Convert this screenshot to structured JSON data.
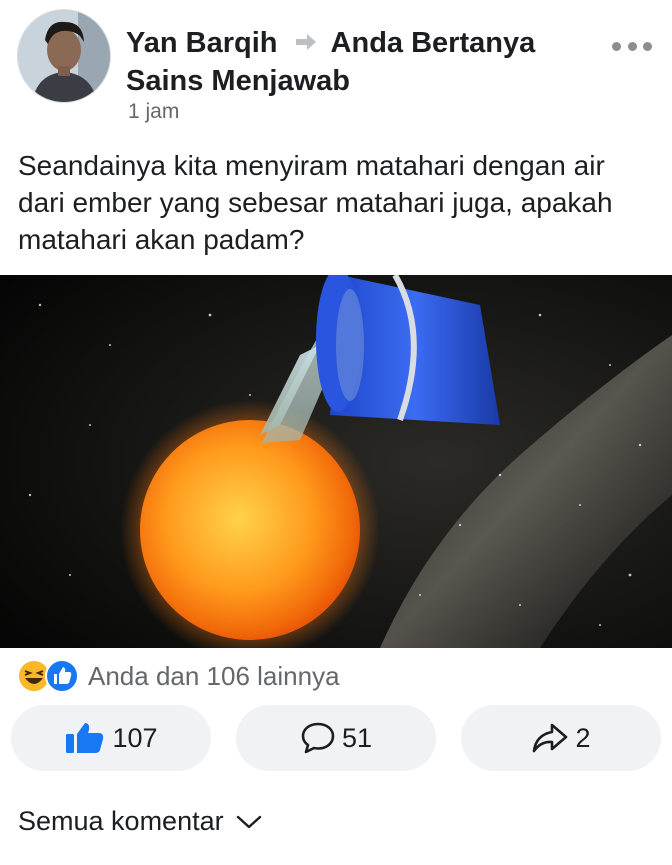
{
  "post": {
    "author": "Yan Barqih",
    "group": "Anda Bertanya Sains Menjawab",
    "time": "1 jam",
    "text": "Seandainya kita menyiram matahari dengan air dari ember yang sebesar matahari juga, apakah matahari akan padam?"
  },
  "reactions": {
    "summary": "Anda dan 106 lainnya",
    "types": [
      "haha",
      "like"
    ]
  },
  "actions": {
    "like_count": "107",
    "comment_count": "51",
    "share_count": "2"
  },
  "comments_filter": {
    "label": "Semua komentar"
  },
  "colors": {
    "like_blue": "#1877f2",
    "secondary_text": "#65676b",
    "pill_bg": "#f0f2f5",
    "haha_yellow": "#f7b928"
  },
  "icons": [
    "share-arrow-icon",
    "like-thumb-icon",
    "comment-bubble-icon",
    "share-icon",
    "chevron-down-icon",
    "more-options-icon"
  ]
}
